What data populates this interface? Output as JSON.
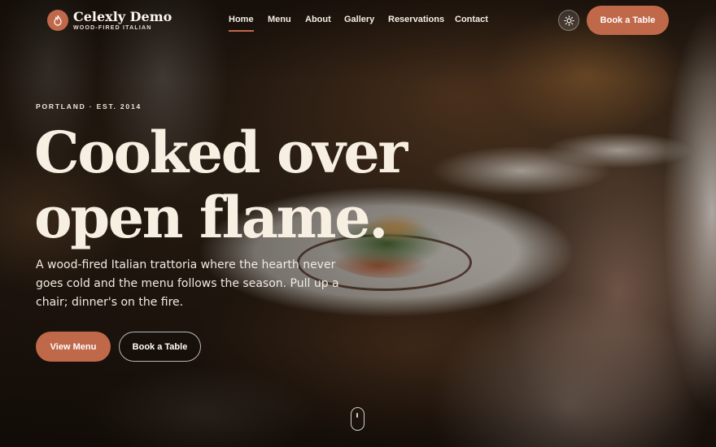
{
  "brand": {
    "name": "Celexly Demo",
    "tagline": "WOOD-FIRED ITALIAN",
    "logo_icon": "flame-icon",
    "accent_color": "#c0684a"
  },
  "nav": {
    "items": [
      {
        "label": "Home",
        "active": true
      },
      {
        "label": "Menu",
        "active": false
      },
      {
        "label": "About",
        "active": false
      },
      {
        "label": "Gallery",
        "active": false
      },
      {
        "label": "Reservations",
        "active": false
      },
      {
        "label": "Contact",
        "active": false
      }
    ],
    "theme_toggle_icon": "sun-icon",
    "cta_label": "Book a Table"
  },
  "hero": {
    "eyebrow": "PORTLAND · EST. 2014",
    "headline_line1": "Cooked over",
    "headline_line2": "open flame.",
    "lede": "A wood-fired Italian trattoria where the hearth never goes cold and the menu follows the season. Pull up a chair; dinner's on the fire.",
    "primary_button": "View Menu",
    "secondary_button": "Book a Table",
    "scroll_icon": "scroll-mouse-icon"
  }
}
